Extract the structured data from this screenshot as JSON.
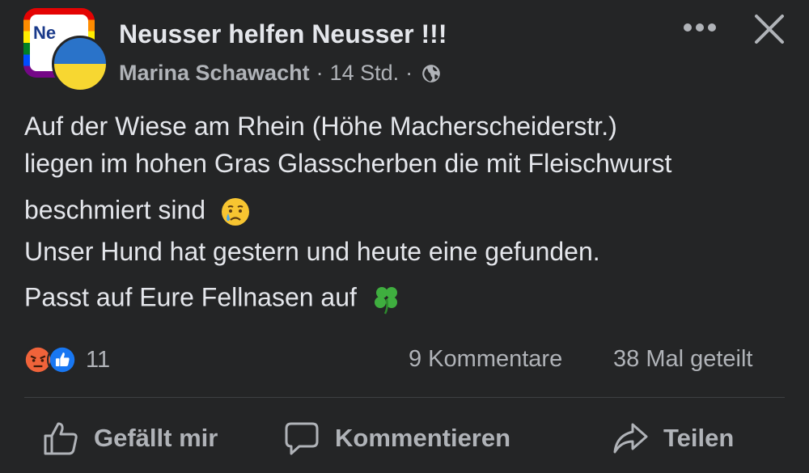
{
  "post": {
    "group_name": "Neusser helfen Neusser !!!",
    "group_avatar_text": "Ne",
    "author": "Marina Schawacht",
    "time": "14 Std.",
    "separator": "·",
    "privacy_icon": "globe-icon",
    "menu_icon": "more-icon",
    "close_icon": "close-icon",
    "text_lines": [
      "Auf der Wiese am Rhein (Höhe Macherscheiderstr.)",
      "liegen im hohen Gras Glasscherben die mit Fleischwurst",
      "beschmiert sind",
      "Unser Hund hat gestern und heute eine gefunden.",
      "Passt auf Eure Fellnasen auf"
    ],
    "emoji": {
      "crying": "crying-face-emoji",
      "clover": "four-leaf-clover-emoji"
    }
  },
  "stats": {
    "reaction_icons": [
      "angry-reaction-icon",
      "like-reaction-icon"
    ],
    "reaction_count": "11",
    "comments": "9 Kommentare",
    "shares": "38 Mal geteilt"
  },
  "actions": {
    "like": "Gefällt mir",
    "comment": "Kommentieren",
    "share": "Teilen"
  },
  "colors": {
    "background": "#242526",
    "primary_text": "#e4e6eb",
    "secondary_text": "#b0b3b8",
    "like_blue": "#1877f2",
    "angry_orange": "#f0633a"
  }
}
